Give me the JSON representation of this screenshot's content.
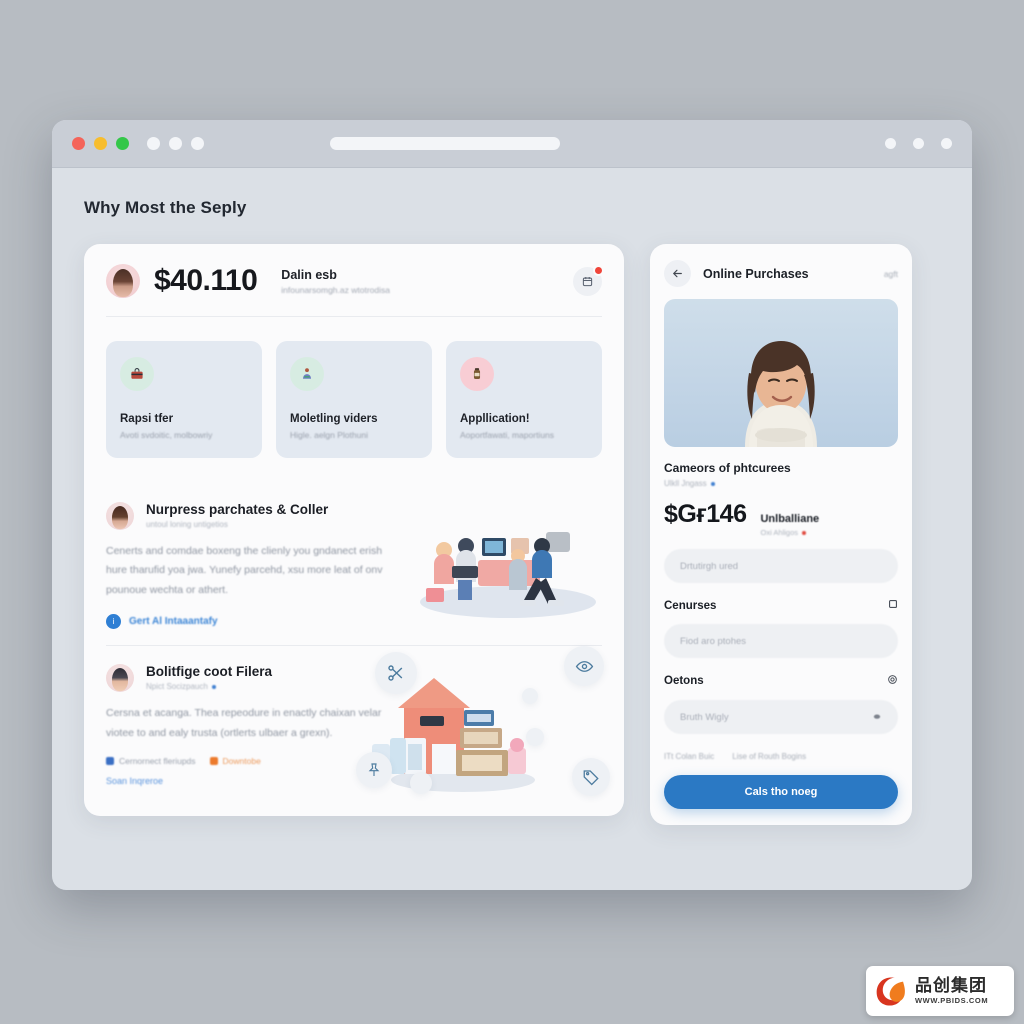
{
  "browser": {
    "traffic_lights": [
      "red",
      "yellow",
      "green"
    ],
    "blank_dots": 3,
    "right_dots": 3,
    "url_value": ""
  },
  "page": {
    "title": "Why Most the Seply"
  },
  "left_card": {
    "header": {
      "amount": "$40.110",
      "title": "Dalin esb",
      "subtitle": "infounarsomgh.az wtotrodisa",
      "notification_icon": "calendar-icon",
      "has_badge": true
    },
    "tiles": [
      {
        "icon": "briefcase-icon",
        "icon_glyph": "💼",
        "icon_bg": "#d7ece2",
        "title": "Rapsi tfer",
        "subtitle": "Avoti svdoitic, molbowriy"
      },
      {
        "icon": "person-shirt-icon",
        "icon_glyph": "🧸",
        "icon_bg": "#d7ece2",
        "title": "Moletling viders",
        "subtitle": "Higle. aelgn Plothuni"
      },
      {
        "icon": "bottle-icon",
        "icon_glyph": "🍾",
        "icon_bg": "#f8cdd4",
        "title": "Appllication!",
        "subtitle": "Aoportfawati, maportiuns"
      }
    ],
    "sections": [
      {
        "avatar": "female-avatar",
        "title": "Nurpress parchates & Coller",
        "subtitle": "untoul loning untigetios",
        "body": "Cenerts and comdae boxeng the clienly you gndanect erish hure tharufid yoa jwa. Yunefy parcehd, xsu more leat of onv pounoue wechta or athert.",
        "link_icon": "info-icon",
        "link_icon_glyph": "ℹ",
        "link_text": "Gert Al Intaaantafy",
        "illustration": "team-desk-illustration"
      },
      {
        "avatar": "male-avatar",
        "title": "Bolitfige coot Filera",
        "subtitle": "Npict Socizpauch",
        "body": "Cersna et acanga. Thea repeodure in enactly chaixan velar viotee to and ealy trusta (ortlerts ulbaer a grexn).",
        "tags": [
          {
            "label": "Cernornect fleriupds",
            "color": "#3a6fc4",
            "kind": "blue"
          },
          {
            "label": "Downtobe",
            "color": "#ec7a2c",
            "kind": "orange"
          }
        ],
        "sub_link": "Soan Inqreroe",
        "illustration": "shop-house-illustration",
        "float_buttons": [
          {
            "name": "scissors-icon",
            "glyph": "✂"
          },
          {
            "name": "eye-icon",
            "glyph": "👁"
          },
          {
            "name": "tag-icon",
            "glyph": "🏷"
          },
          {
            "name": "pin-icon",
            "glyph": "📌"
          }
        ]
      }
    ]
  },
  "right_card": {
    "back_icon": "back-arrow-icon",
    "title": "Online Purchases",
    "action_label": "agft",
    "hero_image_alt": "smiling-woman-photo",
    "heading": "Cameors of phtcurees",
    "heading_sub": "Ulkll Jngass",
    "price": "$Gғ146",
    "price_side_title": "Unlballiane",
    "price_side_sub": "Oxi Ahligos",
    "search_placeholder": "Drtutirgh ured",
    "sections": [
      {
        "label": "Cenurses",
        "icon": "square-icon",
        "icon_glyph": "□",
        "field_placeholder": "Fiod aro ptohes",
        "field_icon": ""
      },
      {
        "label": "Oetons",
        "icon": "gear-icon",
        "icon_glyph": "⚙",
        "field_placeholder": "Bruth Wigly",
        "field_icon": "◉"
      }
    ],
    "meta": [
      "ITt Colan Buic",
      "Lise of Routh Bogins"
    ],
    "cta_label": "Cals tho noeg"
  },
  "watermark": {
    "cn_text": "品创集团",
    "url": "WWW.PBIDS.COM",
    "logo": "red-leaf-logo"
  },
  "colors": {
    "accent_blue": "#2b79c4",
    "badge_red": "#f0453a",
    "tag_orange": "#ec7a2c",
    "page_bg": "#b7bcc2"
  }
}
